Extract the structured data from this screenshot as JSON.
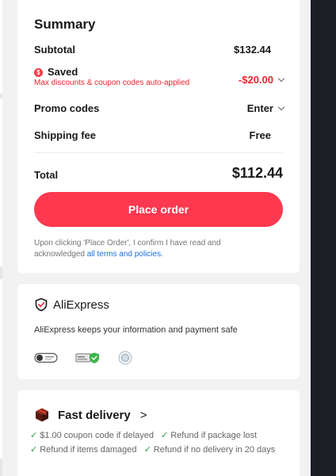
{
  "summary": {
    "title": "Summary",
    "subtotal_label": "Subtotal",
    "subtotal_value": "$132.44",
    "saved_label": "Saved",
    "saved_note": "Max discounts & coupon codes auto-applied",
    "saved_value": "-$20.00",
    "promo_label": "Promo codes",
    "promo_value": "Enter",
    "shipping_label": "Shipping fee",
    "shipping_value": "Free",
    "total_label": "Total",
    "total_value": "$112.44",
    "place_order_label": "Place order",
    "legal_text": "Upon clicking 'Place Order', I confirm I have read and acknowledged",
    "legal_link": "all terms and policies",
    "legal_end": "."
  },
  "security": {
    "brand_name": "AliExpress",
    "safe_text": "AliExpress keeps your information and payment safe",
    "badges": [
      "privacy-toggle-badge",
      "secure-shield-badge",
      "certification-seal-badge"
    ]
  },
  "delivery": {
    "title": "Fast delivery",
    "arrow": ">",
    "benefits": [
      "$1.00 coupon code if delayed",
      "Refund if package lost",
      "Refund if items damaged",
      "Refund if no delivery in 20 days"
    ]
  },
  "icons": {
    "chevron": "chevron-down-icon",
    "check": "checkmark-icon",
    "shield": "shield-check-icon",
    "cube": "package-cube-icon"
  },
  "colors": {
    "accent": "#fd384f",
    "saved_red": "#f0222f",
    "link": "#1e6fe0",
    "check_green": "#2e9b47",
    "rail_dark": "#1c1e26"
  }
}
